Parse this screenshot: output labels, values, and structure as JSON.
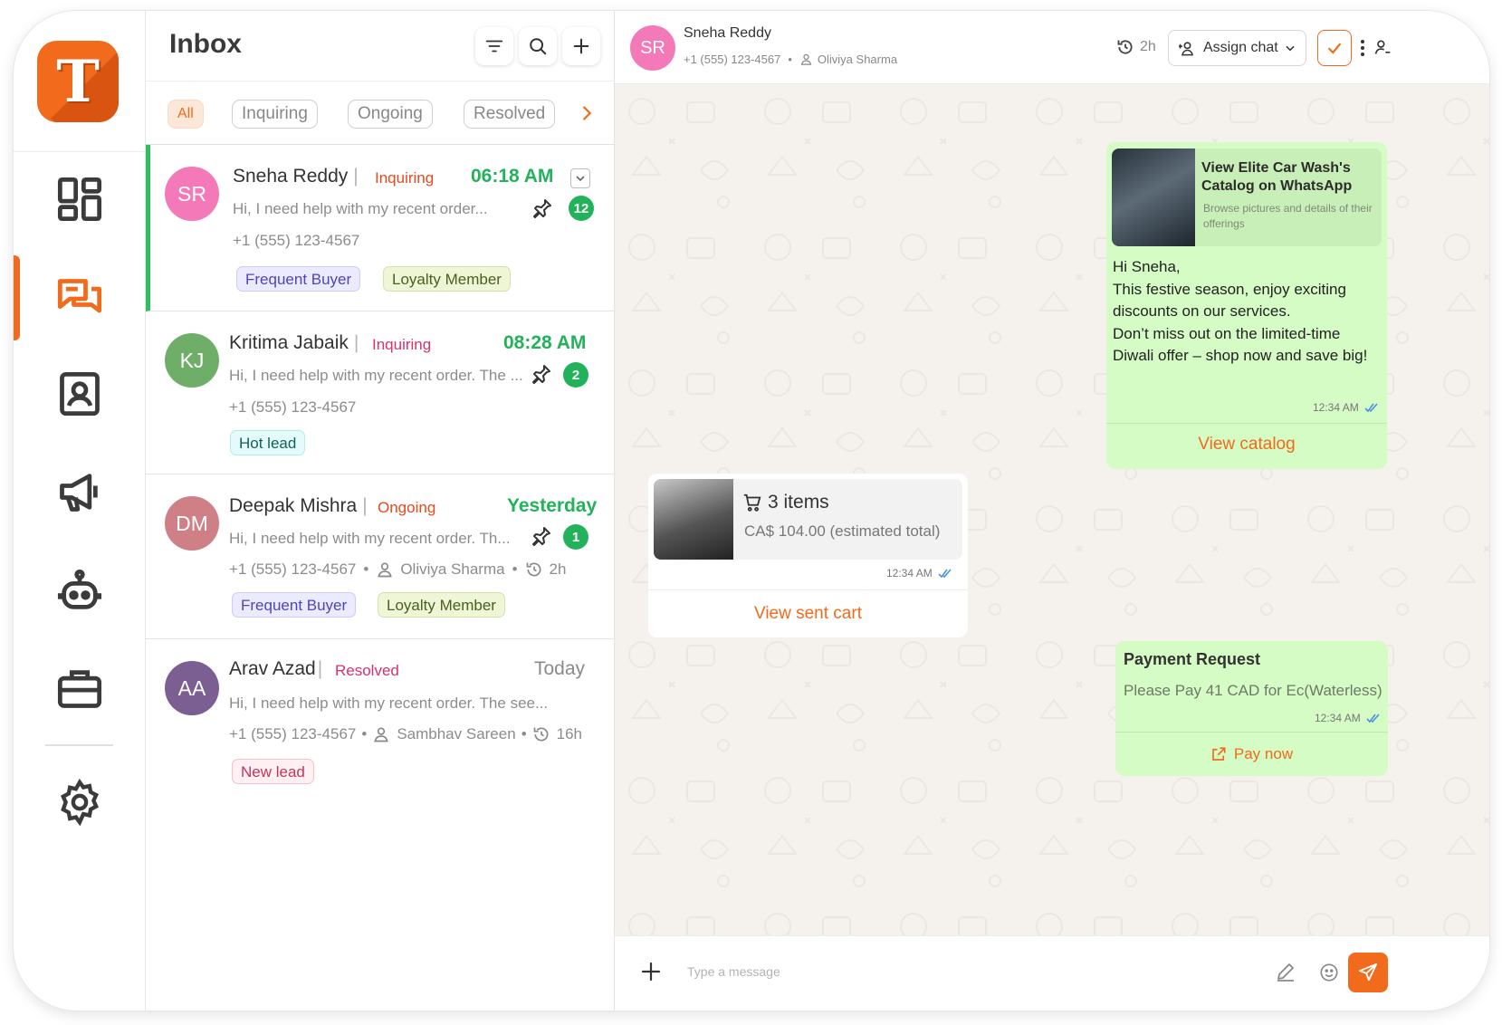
{
  "app": {
    "logo_letter": "T",
    "brand_color": "#f26a1b"
  },
  "rail": {
    "items": [
      {
        "name": "dashboard",
        "icon": "dashboard-icon",
        "active": false
      },
      {
        "name": "inbox",
        "icon": "chat-bubbles-icon",
        "active": true
      },
      {
        "name": "contacts",
        "icon": "contact-card-icon",
        "active": false
      },
      {
        "name": "campaigns",
        "icon": "megaphone-icon",
        "active": false
      },
      {
        "name": "bots",
        "icon": "robot-icon",
        "active": false
      },
      {
        "name": "business",
        "icon": "briefcase-icon",
        "active": false
      },
      {
        "name": "settings",
        "icon": "gear-icon",
        "active": false
      }
    ]
  },
  "inbox": {
    "title": "Inbox",
    "filters": [
      "All",
      "Inquiring",
      "Ongoing",
      "Resolved"
    ],
    "active_filter": "All",
    "conversations": [
      {
        "initials": "SR",
        "name": "Sneha Reddy",
        "status": "Inquiring",
        "time": "06:18 AM",
        "preview": "Hi, I need help with my recent order...",
        "phone": "+1 (555) 123-4567",
        "unread": "12",
        "tags": [
          "Frequent Buyer",
          "Loyalty Member"
        ],
        "avatar_color": "#f479b8"
      },
      {
        "initials": "KJ",
        "name": "Kritima Jabaik",
        "status": "Inquiring",
        "time": "08:28 AM",
        "preview": "Hi, I need help with my recent order. The ...",
        "phone": "+1 (555) 123-4567",
        "unread": "2",
        "tags": [
          "Hot lead"
        ],
        "avatar_color": "#6fae69"
      },
      {
        "initials": "DM",
        "name": "Deepak Mishra",
        "status": "Ongoing",
        "time": "Yesterday",
        "preview": "Hi, I need help with my recent order. Th...",
        "phone": "+1 (555) 123-4567",
        "agent": "Oliviya Sharma",
        "wait": "2h",
        "unread": "1",
        "tags": [
          "Frequent Buyer",
          "Loyalty Member"
        ],
        "avatar_color": "#cf7f86"
      },
      {
        "initials": "AA",
        "name": "Arav Azad",
        "status": "Resolved",
        "time": "Today",
        "preview": "Hi, I need help with my recent order. The see...",
        "phone": "+1 (555) 123-4567",
        "agent": "Sambhav Sareen",
        "wait": "16h",
        "tags": [
          "New lead"
        ],
        "avatar_color": "#7b5e92"
      }
    ]
  },
  "chat": {
    "contact": {
      "initials": "SR",
      "name": "Sneha Reddy",
      "phone": "+1 (555) 123-4567",
      "agent": "Oliviya Sharma"
    },
    "header": {
      "elapsed": "2h",
      "assign_label": "Assign chat"
    },
    "messages": {
      "catalog": {
        "title": "View Elite Car Wash's Catalog on WhatsApp",
        "description": "Browse pictures and details of their offerings",
        "body": "Hi Sneha,\nThis festive season, enjoy exciting discounts on our services.\nDon’t miss out on the limited-time Diwali offer – shop now and save big!",
        "time": "12:34 AM",
        "action": "View catalog"
      },
      "cart": {
        "items": "3 items",
        "total": "CA$ 104.00 (estimated total)",
        "time": "12:34 AM",
        "action": "View sent cart"
      },
      "payment": {
        "title": "Payment Request",
        "description": "Please Pay 41 CAD for Ec(Waterless)",
        "time": "12:34 AM",
        "action": "Pay now"
      }
    },
    "composer": {
      "placeholder": "Type a message"
    }
  }
}
